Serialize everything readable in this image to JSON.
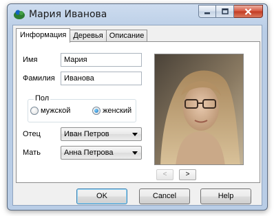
{
  "window": {
    "title": "Мария Иванова",
    "icons": {
      "app": "person-app-icon",
      "minimize": "minimize-icon",
      "maximize": "maximize-icon",
      "close": "close-icon"
    }
  },
  "tabs": [
    {
      "label": "Информация",
      "active": true
    },
    {
      "label": "Деревья",
      "active": false
    },
    {
      "label": "Описание",
      "active": false
    }
  ],
  "form": {
    "first_name": {
      "label": "Имя",
      "value": "Мария"
    },
    "last_name": {
      "label": "Фамилия",
      "value": "Иванова"
    },
    "gender": {
      "caption": "Пол",
      "options": [
        {
          "label": "мужской",
          "checked": false
        },
        {
          "label": "женский",
          "checked": true
        }
      ]
    },
    "father": {
      "label": "Отец",
      "value": "Иван Петров"
    },
    "mother": {
      "label": "Мать",
      "value": "Анна Петрова"
    }
  },
  "photo": {
    "prev_label": "<",
    "next_label": ">",
    "prev_enabled": false,
    "next_enabled": true
  },
  "buttons": {
    "ok": "OK",
    "cancel": "Cancel",
    "help": "Help"
  },
  "colors": {
    "title_bar": "#b9cde6",
    "close_button": "#c7432b",
    "accent_radio": "#1b6fb8"
  }
}
